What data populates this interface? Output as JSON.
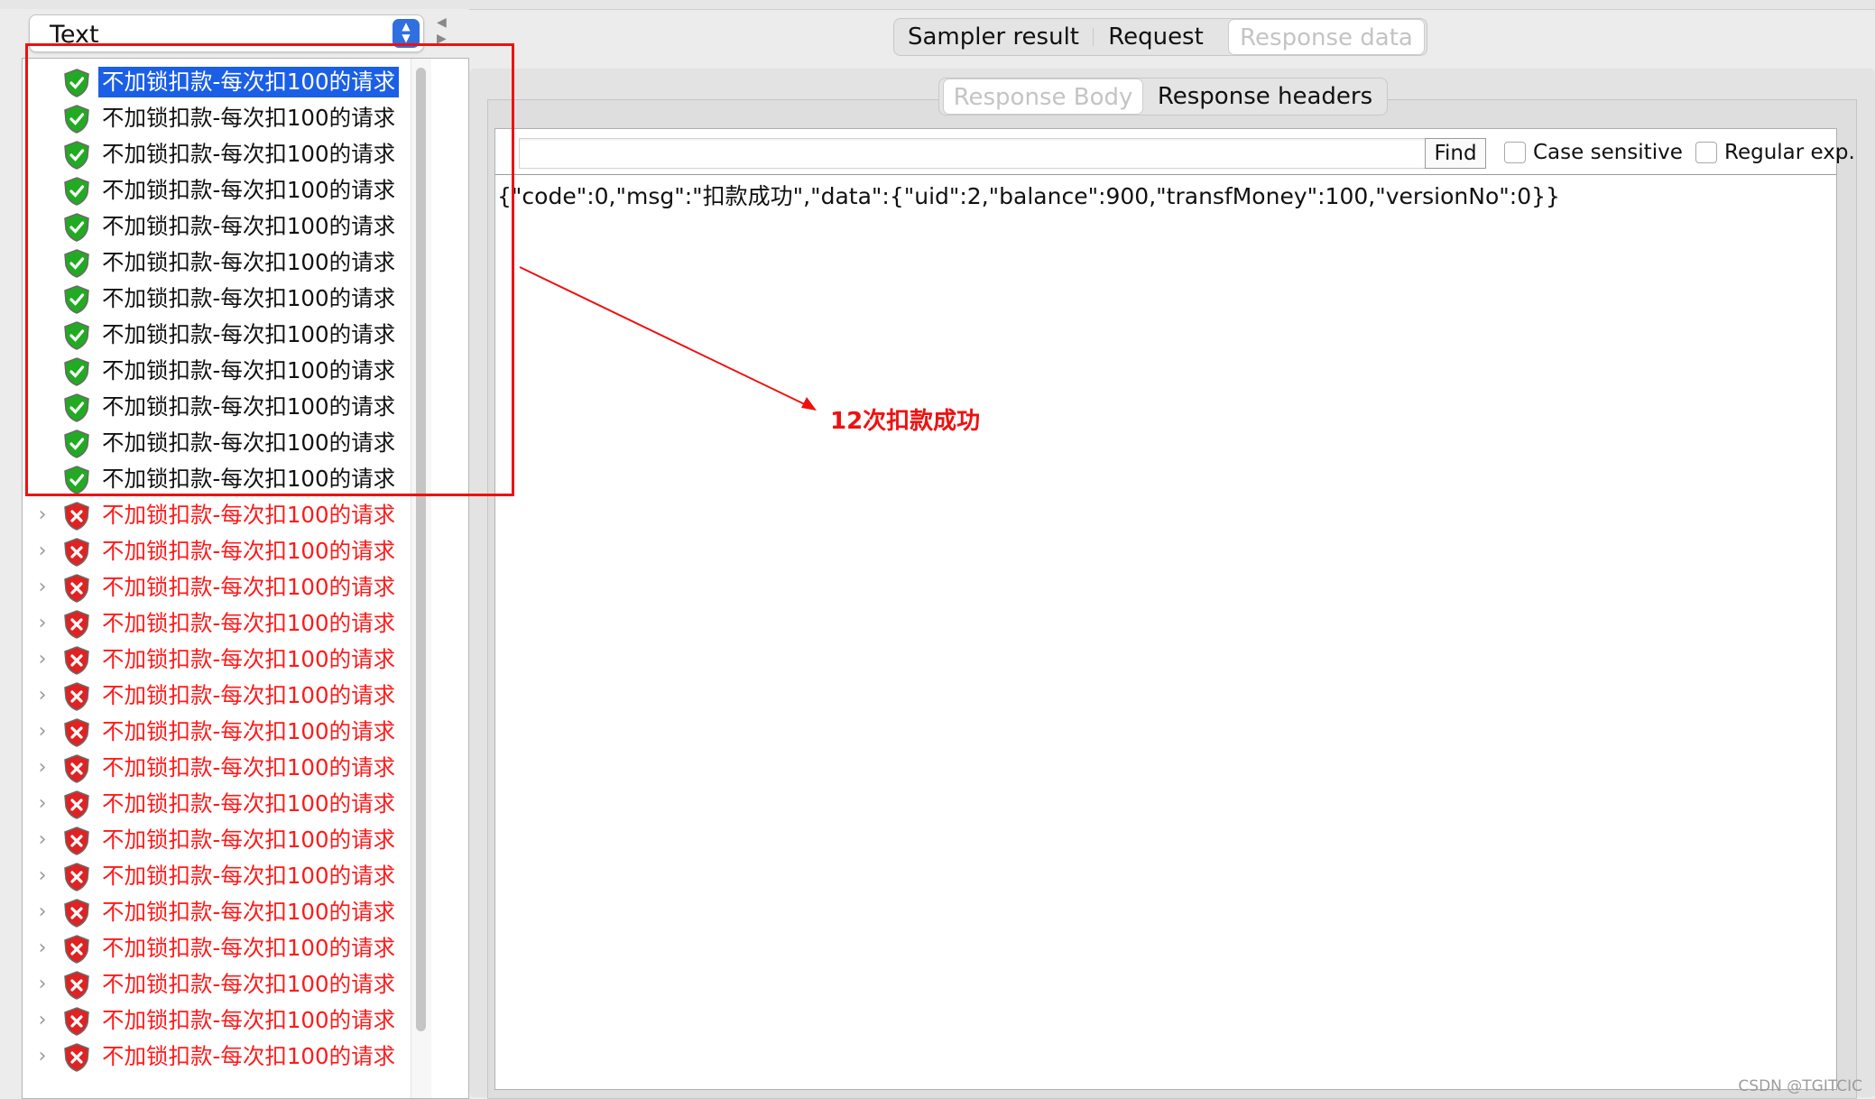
{
  "renderer": {
    "selected": "Text"
  },
  "tabs": {
    "top": [
      "Sampler result",
      "Request",
      "Response data"
    ],
    "top_active": "Response data",
    "sub": [
      "Response Body",
      "Response headers"
    ],
    "sub_active": "Response Body"
  },
  "search": {
    "value": "",
    "find_label": "Find",
    "case_sensitive_label": "Case sensitive",
    "regex_label": "Regular exp."
  },
  "response": {
    "body": "{\"code\":0,\"msg\":\"扣款成功\",\"data\":{\"uid\":2,\"balance\":900,\"transfMoney\":100,\"versionNo\":0}}"
  },
  "tree": {
    "label": "不加锁扣款-每次扣100的请求",
    "rows": [
      {
        "status": "success",
        "selected": true
      },
      {
        "status": "success"
      },
      {
        "status": "success"
      },
      {
        "status": "success"
      },
      {
        "status": "success"
      },
      {
        "status": "success"
      },
      {
        "status": "success"
      },
      {
        "status": "success"
      },
      {
        "status": "success"
      },
      {
        "status": "success"
      },
      {
        "status": "success"
      },
      {
        "status": "success"
      },
      {
        "status": "error"
      },
      {
        "status": "error"
      },
      {
        "status": "error"
      },
      {
        "status": "error"
      },
      {
        "status": "error"
      },
      {
        "status": "error"
      },
      {
        "status": "error"
      },
      {
        "status": "error"
      },
      {
        "status": "error"
      },
      {
        "status": "error"
      },
      {
        "status": "error"
      },
      {
        "status": "error"
      },
      {
        "status": "error"
      },
      {
        "status": "error"
      },
      {
        "status": "error"
      },
      {
        "status": "error"
      }
    ]
  },
  "annotation": {
    "text": "12次扣款成功",
    "color": "#ee1111"
  },
  "colors": {
    "success": "#22aa22",
    "error": "#e02222",
    "selection": "#1a5fe6",
    "error_text": "#ff1a1a"
  },
  "watermark": "CSDN @TGITCIC"
}
